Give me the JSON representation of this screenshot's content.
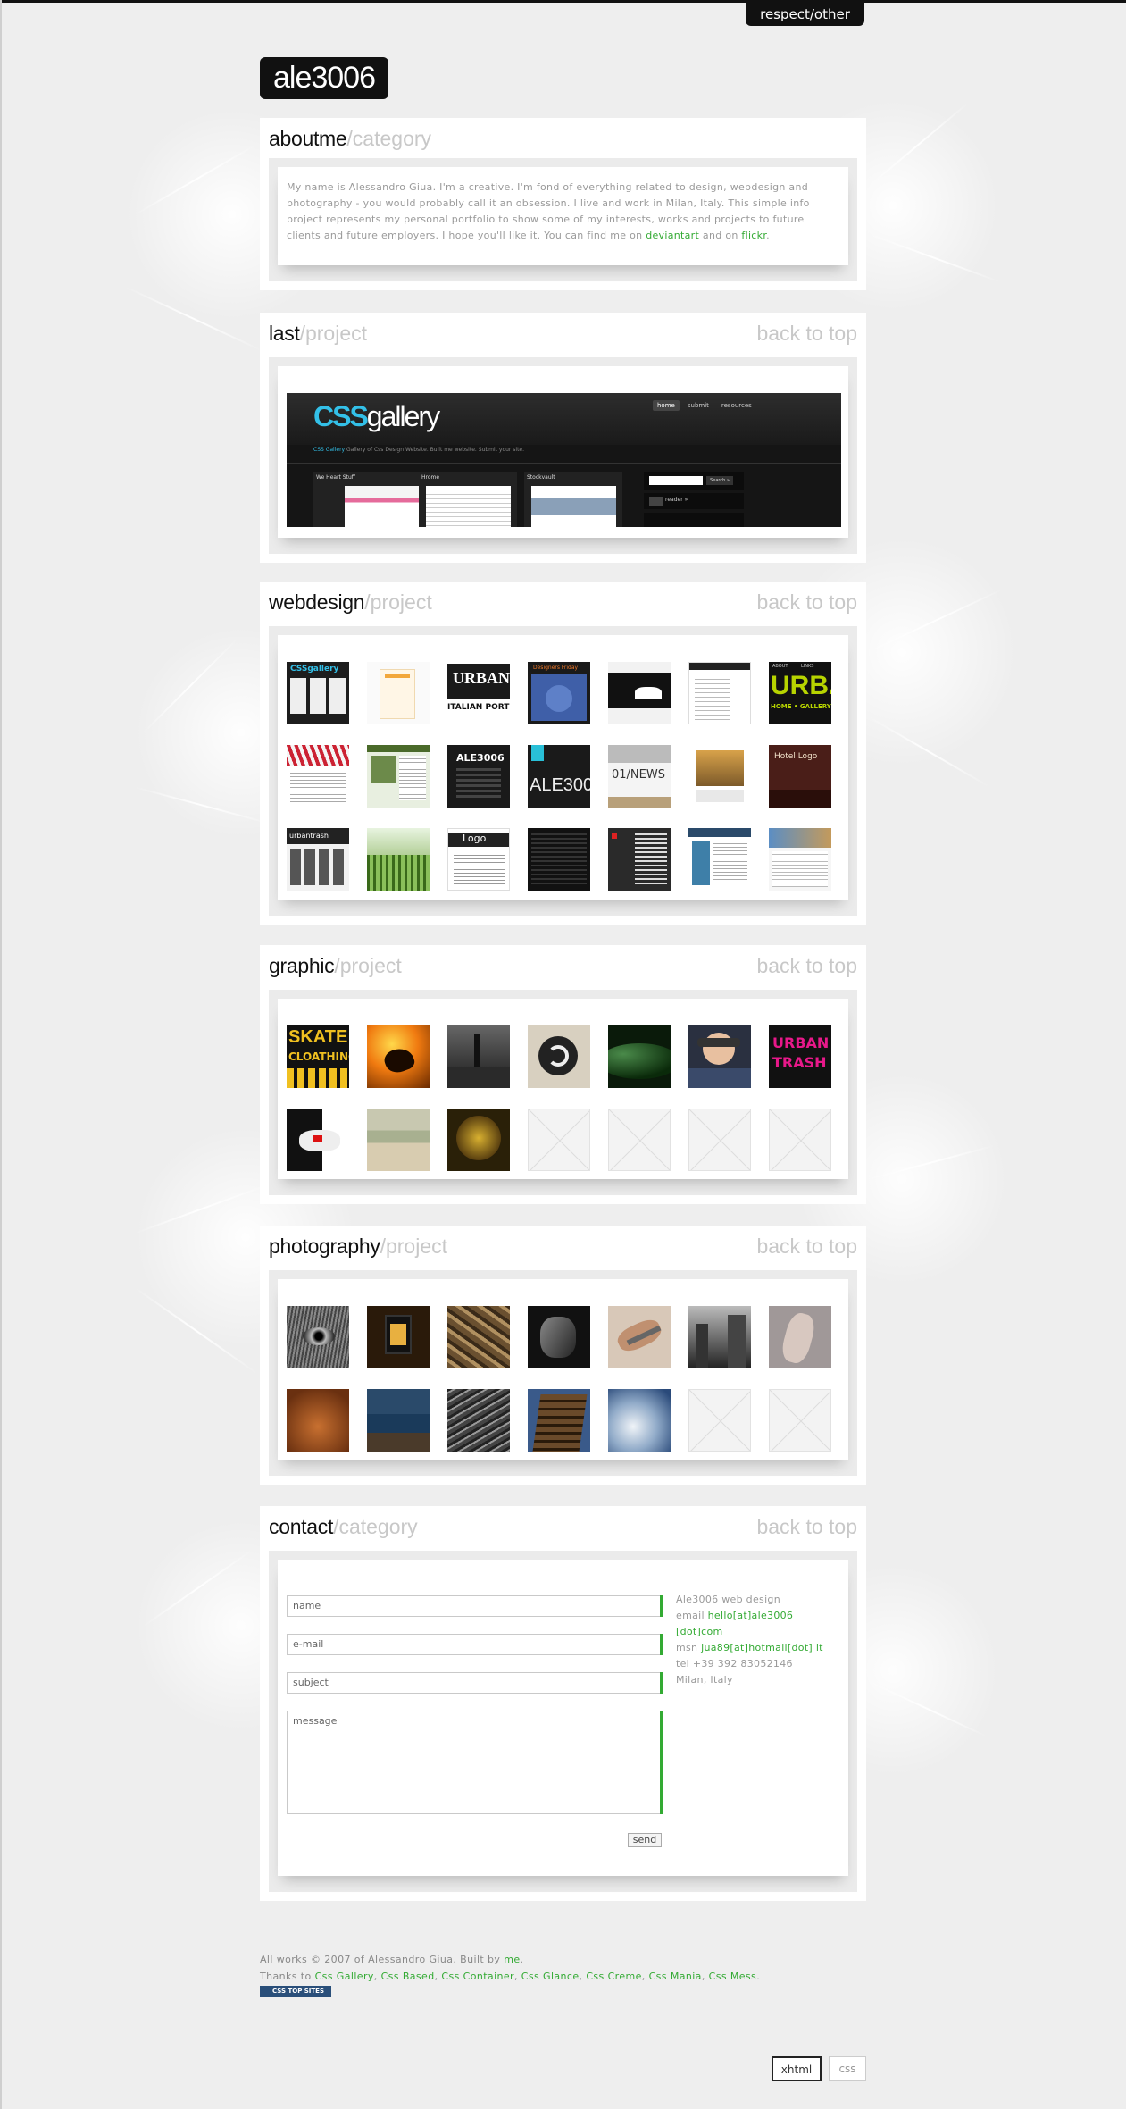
{
  "topnav": {
    "tab_label": "respect/other"
  },
  "logo": {
    "text": "ale3006"
  },
  "colors": {
    "accent": "#33aa33",
    "dark": "#111111",
    "muted": "#c8c8c8",
    "panel": "#ebebeb"
  },
  "about": {
    "title": "aboutme",
    "sub": "/category",
    "text": "My name is Alessandro Giua. I'm a creative. I'm fond of everything related to design, webdesign and photography - you would probably call it an obsession. I live and work in Milan, Italy. This simple info project represents my personal portfolio to show some of my interests, works and projects to future clients and future employers. I hope you'll like it. You can find me on",
    "link1": "deviantart",
    "mid": "and on",
    "link2": "flickr",
    "end": "."
  },
  "last": {
    "title": "last",
    "sub": "/project",
    "back": "back to top",
    "preview": {
      "brand_a": "CSS",
      "brand_b": "gallery",
      "nav": [
        "home",
        "submit",
        "resources"
      ],
      "tagline_a": "CSS Gallery",
      "tagline_b": "Gallery of Css Design Website. Built me website. Submit your site.",
      "cols": [
        "We Heart Stuff",
        "Hrome",
        "Stockvault"
      ],
      "search_button": "Search »",
      "side_item": "reader »"
    }
  },
  "webdesign": {
    "title": "webdesign",
    "sub": "/project",
    "back": "back to top",
    "thumb_labels": [
      "CSSgallery",
      "URBAN",
      "ITALIAN PORT",
      "Designers Friday",
      "URBA",
      "HOME • GALLERY •",
      "ABOUT",
      "LINKS",
      "ALE3006",
      "ALE300",
      "01/NEWS",
      "Hotel Logo",
      "urbantrash",
      "Logo"
    ]
  },
  "graphic": {
    "title": "graphic",
    "sub": "/project",
    "back": "back to top",
    "thumb_labels": [
      "SKATE",
      "CLOATHING",
      "URBAN",
      "TRASH"
    ]
  },
  "photography": {
    "title": "photography",
    "sub": "/project",
    "back": "back to top"
  },
  "contact": {
    "title": "contact",
    "sub": "/category",
    "back": "back to top",
    "fields": [
      "name",
      "e-mail",
      "subject"
    ],
    "message_placeholder": "message",
    "send_label": "send",
    "info": {
      "line1": "Ale3006 web design",
      "email_label": "email",
      "email_value": "hello[at]ale3006 [dot]com",
      "msn_label": "msn",
      "msn_value": "jua89[at]hotmail[dot] it",
      "tel": "tel +39 392 83052146",
      "city": "Milan, Italy"
    }
  },
  "footer": {
    "line1_a": "All works © 2007 of Alessandro Giua. Built by",
    "line1_link": "me",
    "line1_end": ".",
    "line2_a": "Thanks to",
    "thanks_links": [
      "Css Gallery",
      "Css Based",
      "Css Container",
      "Css Glance",
      "Css Creme",
      "Css Mania",
      "Css Mess"
    ],
    "badge_text": "CSS TOP SITES"
  },
  "validators": {
    "xhtml": "xhtml",
    "css": "css"
  }
}
